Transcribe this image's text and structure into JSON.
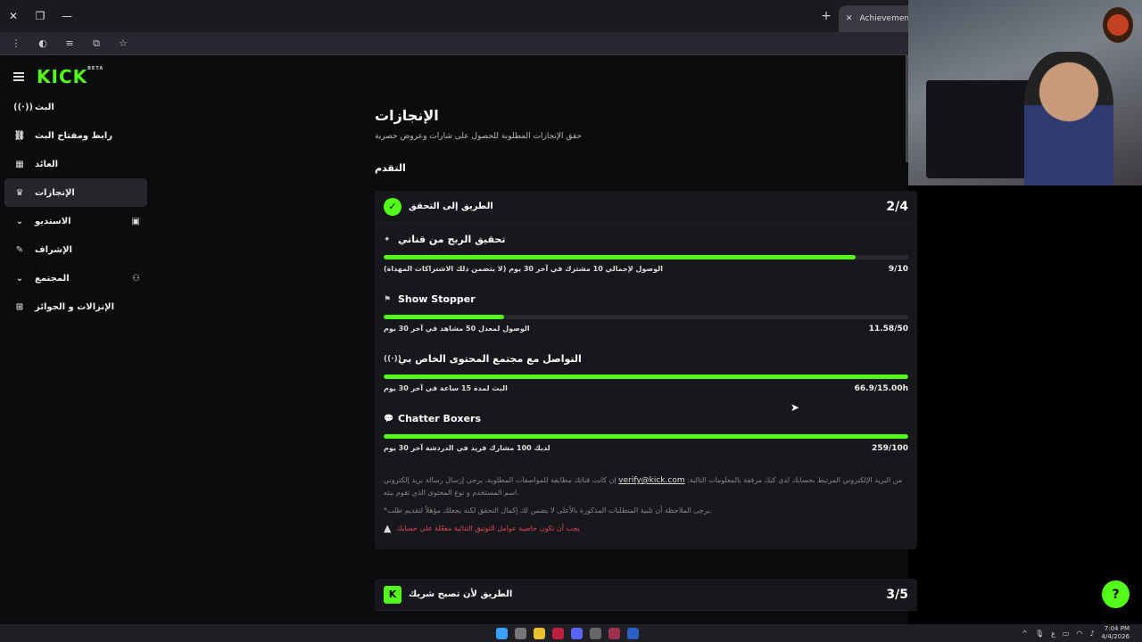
{
  "browser": {
    "close_icon": "✕",
    "tab_title": "Achievements -"
  },
  "sidebar": {
    "logo": "KICK",
    "beta": "BETA",
    "items": [
      {
        "label": "البث",
        "icon": "((·))"
      },
      {
        "label": "رابط ومفتاح البث",
        "icon": "🔗"
      },
      {
        "label": "العائد",
        "icon": "▦"
      },
      {
        "label": "الإنجازات",
        "icon": "🏆"
      },
      {
        "label": "الاستديو",
        "icon": "⌄"
      },
      {
        "label": "الإشراف",
        "icon": "🔧"
      },
      {
        "label": "المجتمع",
        "icon": "⌄"
      },
      {
        "label": "الإنزالات و الجوائز",
        "icon": "⊞"
      }
    ]
  },
  "main": {
    "title": "الإنجازات",
    "subtitle": "حقق الإنجازات المطلوبة للحصول على شارات وعروض حصرية",
    "section": "التقدم",
    "card1": {
      "title": "الطريق إلى التحقق",
      "count": "2/4",
      "achievements": [
        {
          "title": "تحقيق الربح من قناتي",
          "desc": "الوصول لإجمالي 10 مشترك في آخر 30 يوم (لا يتضمن ذلك الاشتراكات المهداة)",
          "value": "9/10",
          "progress": 0.9
        },
        {
          "title": "Show Stopper",
          "desc": "الوصول لمعدل 50 مشاهد في آخر 30 يوم",
          "value": "11.58/50",
          "progress": 0.23
        },
        {
          "title": "التواصل مع مجتمع المحتوى الخاص بي",
          "desc": "البث لمدة 15 ساعة في آخر 30 يوم",
          "value": "66.9/15.00h",
          "progress": 1.0
        },
        {
          "title": "Chatter Boxers",
          "desc": "لديك 100 مشارك فريد في الدردشة آخر 30 يوم",
          "value": "259/100",
          "progress": 1.0
        }
      ],
      "note_line1_a": "إن كانت قناتك مطابقة للمواصفات المطلوبة، يرجى إرسال رسالة بريد إلكتروني",
      "note_email": "verify@kick.com",
      "note_line1_b": "من البريد الإلكتروني المرتبط بحسابك لدى كيك مرفقة بالمعلومات التالية: اسم المستخدم و نوع المحتوى الذي تقوم ببثه.",
      "note_line2": "*يرجى الملاحظة أن تلبية المتطلبات المذكورة بالأعلى لا يضمن لك إكمال التحقق لكنه يجعلك مؤهلاً لتقديم طلب.",
      "warning": "يجب أن تكون خاصية عوامل التوثيق الثنائية مفعّلة على حسابك"
    },
    "card2": {
      "title": "الطريق لأن تصبح شريك",
      "count": "3/5"
    }
  },
  "taskbar": {
    "time": "7:04 PM",
    "date": "4/4/2026",
    "lang": "ع"
  },
  "colors": {
    "accent": "#53fc18",
    "warning": "#e0445a"
  }
}
